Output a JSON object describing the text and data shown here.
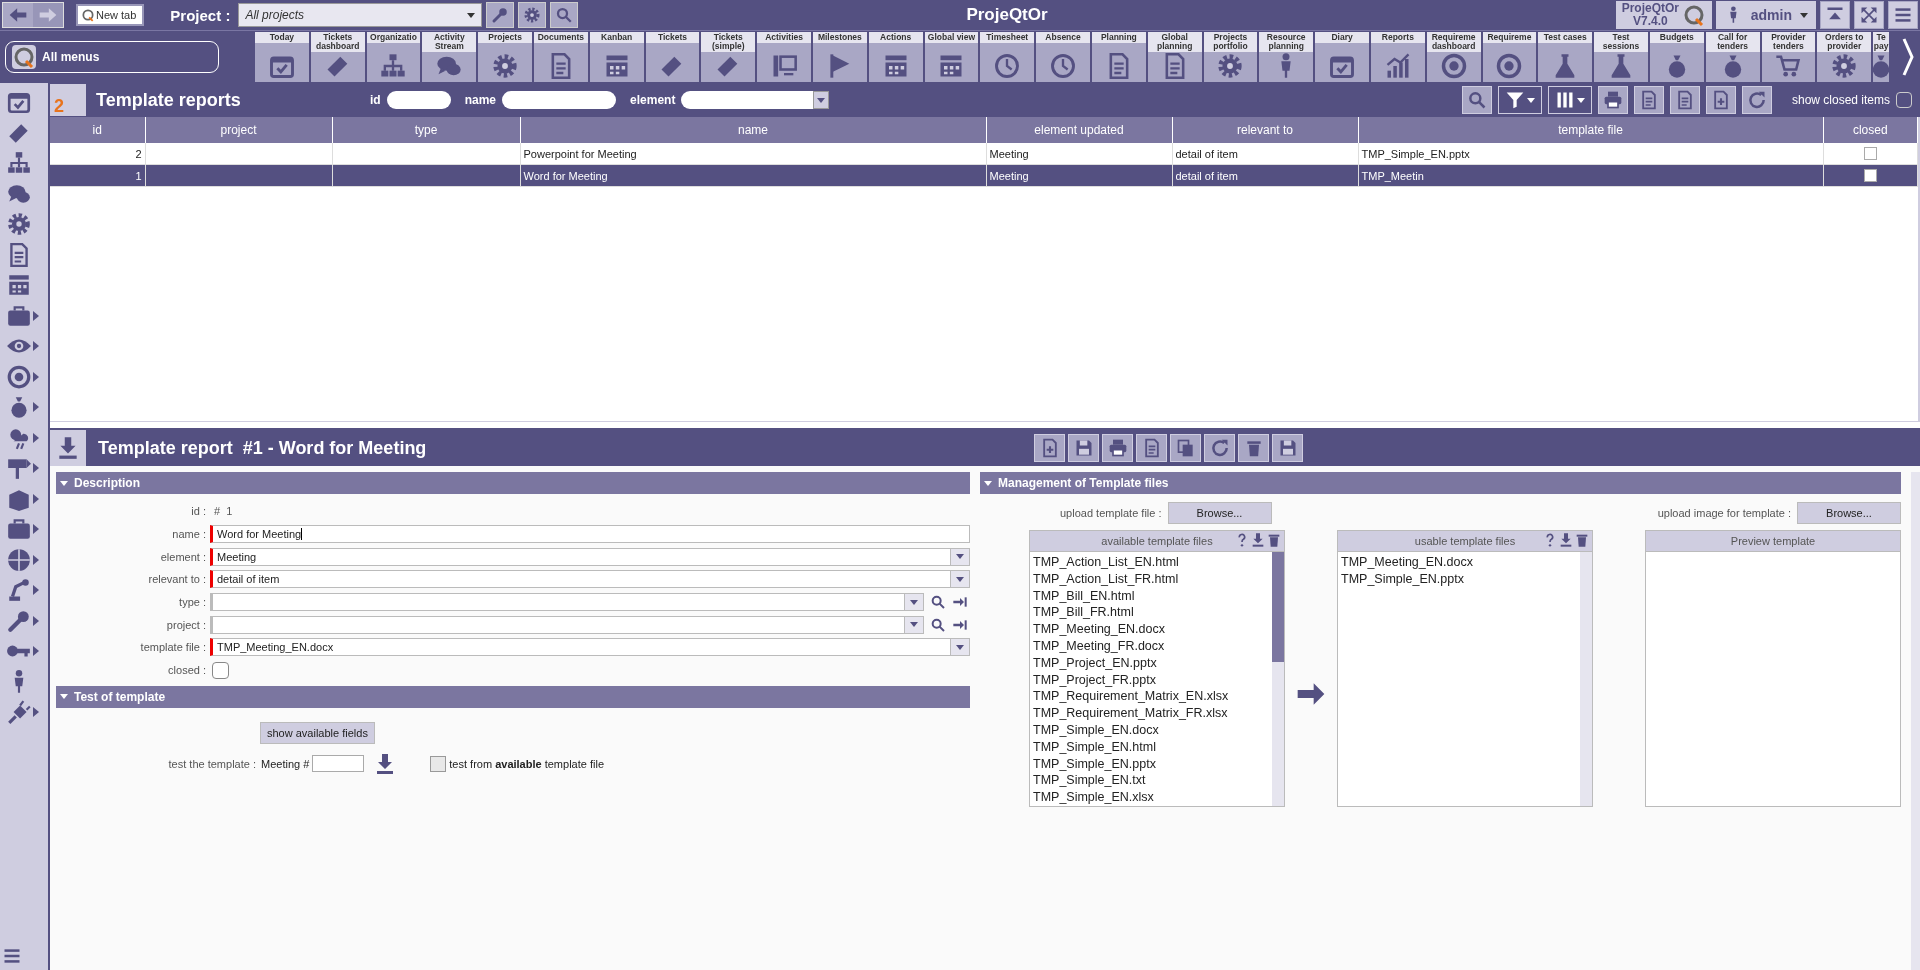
{
  "top_bar": {
    "new_tab": "New tab",
    "project_label": "Project :",
    "project_value": "All projects",
    "title": "ProjeQtOr",
    "product": "ProjeQtOr",
    "version": "V7.4.0",
    "user": "admin"
  },
  "main_menu": {
    "label": "All menus",
    "tiles": [
      {
        "label": "Today"
      },
      {
        "label": "Tickets dashboard"
      },
      {
        "label": "Organizatio"
      },
      {
        "label": "Activity Stream"
      },
      {
        "label": "Projects"
      },
      {
        "label": "Documents"
      },
      {
        "label": "Kanban"
      },
      {
        "label": "Tickets"
      },
      {
        "label": "Tickets (simple)"
      },
      {
        "label": "Activities"
      },
      {
        "label": "Milestones"
      },
      {
        "label": "Actions"
      },
      {
        "label": "Global view"
      },
      {
        "label": "Timesheet"
      },
      {
        "label": "Absence"
      },
      {
        "label": "Planning"
      },
      {
        "label": "Global planning"
      },
      {
        "label": "Projects portfolio"
      },
      {
        "label": "Resource planning"
      },
      {
        "label": "Diary"
      },
      {
        "label": "Reports"
      },
      {
        "label": "Requireme dashboard"
      },
      {
        "label": "Requireme"
      },
      {
        "label": "Test cases"
      },
      {
        "label": "Test sessions"
      },
      {
        "label": "Budgets"
      },
      {
        "label": "Call for tenders"
      },
      {
        "label": "Provider tenders"
      },
      {
        "label": "Orders to provider"
      },
      {
        "label": "Te pay"
      }
    ]
  },
  "sidebar": {
    "items": [
      {
        "expandable": false
      },
      {
        "expandable": false
      },
      {
        "expandable": false
      },
      {
        "expandable": false
      },
      {
        "expandable": false
      },
      {
        "expandable": false
      },
      {
        "expandable": false
      },
      {
        "expandable": true
      },
      {
        "expandable": true
      },
      {
        "expandable": true
      },
      {
        "expandable": true
      },
      {
        "expandable": true
      },
      {
        "expandable": true
      },
      {
        "expandable": true
      },
      {
        "expandable": true
      },
      {
        "expandable": true
      },
      {
        "expandable": true
      },
      {
        "expandable": true
      },
      {
        "expandable": true
      },
      {
        "expandable": false
      },
      {
        "expandable": true
      }
    ]
  },
  "list": {
    "count": "2",
    "title": "Template reports",
    "filters": [
      {
        "label": "id",
        "kind": "text"
      },
      {
        "label": "name",
        "kind": "text"
      },
      {
        "label": "element",
        "kind": "select"
      }
    ],
    "show_closed": {
      "label": "show closed items",
      "checked": false
    },
    "columns": [
      "id",
      "project",
      "type",
      "name",
      "element updated",
      "relevant to",
      "template file",
      "closed"
    ],
    "rows": [
      {
        "id": "2",
        "name": "Powerpoint for Meeting",
        "element_updated": "Meeting",
        "relevant_to": "detail of item",
        "template_file": "TMP_Simple_EN.pptx",
        "closed": false,
        "selected": false
      },
      {
        "id": "1",
        "name": "Word for Meeting",
        "element_updated": "Meeting",
        "relevant_to": "detail of item",
        "template_file": "TMP_Meetin",
        "closed": false,
        "selected": true
      }
    ]
  },
  "detail": {
    "title": "Template report  #1 - Word for Meeting",
    "description": {
      "title": "Description",
      "fields": [
        {
          "label": "id :",
          "kind": "static",
          "value": "#  1"
        },
        {
          "label": "name :",
          "kind": "text",
          "value": "Word for Meeting",
          "required": true
        },
        {
          "label": "element :",
          "kind": "select",
          "value": "Meeting",
          "required": true,
          "lookup": false
        },
        {
          "label": "relevant to  :",
          "kind": "select",
          "value": "detail of item",
          "required": true,
          "lookup": false
        },
        {
          "label": "type :",
          "kind": "select",
          "required": false,
          "lookup": true
        },
        {
          "label": "project :",
          "kind": "select",
          "required": false,
          "lookup": true
        },
        {
          "label": "template file :",
          "kind": "select",
          "value": "TMP_Meeting_EN.docx",
          "required": true,
          "lookup": false
        },
        {
          "label": "closed :",
          "kind": "checkbox",
          "checked": false
        }
      ]
    },
    "test": {
      "title": "Test of template",
      "button": "show available fields",
      "label": "test the template :",
      "prefix": "Meeting #",
      "option_text": "test from **available** template file",
      "option_checked": false
    },
    "management": {
      "title": "Management of Template files",
      "upload_label": "upload template file :",
      "browse": "Browse...",
      "upload_image_label": "upload image for template :",
      "browse_image": "Browse...",
      "available": {
        "title": "available template files",
        "files": [
          "TMP_Action_List_EN.html",
          "TMP_Action_List_FR.html",
          "TMP_Bill_EN.html",
          "TMP_Bill_FR.html",
          "TMP_Meeting_EN.docx",
          "TMP_Meeting_FR.docx",
          "TMP_Project_EN.pptx",
          "TMP_Project_FR.pptx",
          "TMP_Requirement_Matrix_EN.xlsx",
          "TMP_Requirement_Matrix_FR.xlsx",
          "TMP_Simple_EN.docx",
          "TMP_Simple_EN.html",
          "TMP_Simple_EN.pptx",
          "TMP_Simple_EN.txt",
          "TMP_Simple_EN.xlsx"
        ]
      },
      "usable": {
        "title": "usable template files",
        "files": [
          "TMP_Meeting_EN.docx",
          "TMP_Simple_EN.pptx"
        ]
      },
      "preview": {
        "title": "Preview template"
      }
    }
  }
}
